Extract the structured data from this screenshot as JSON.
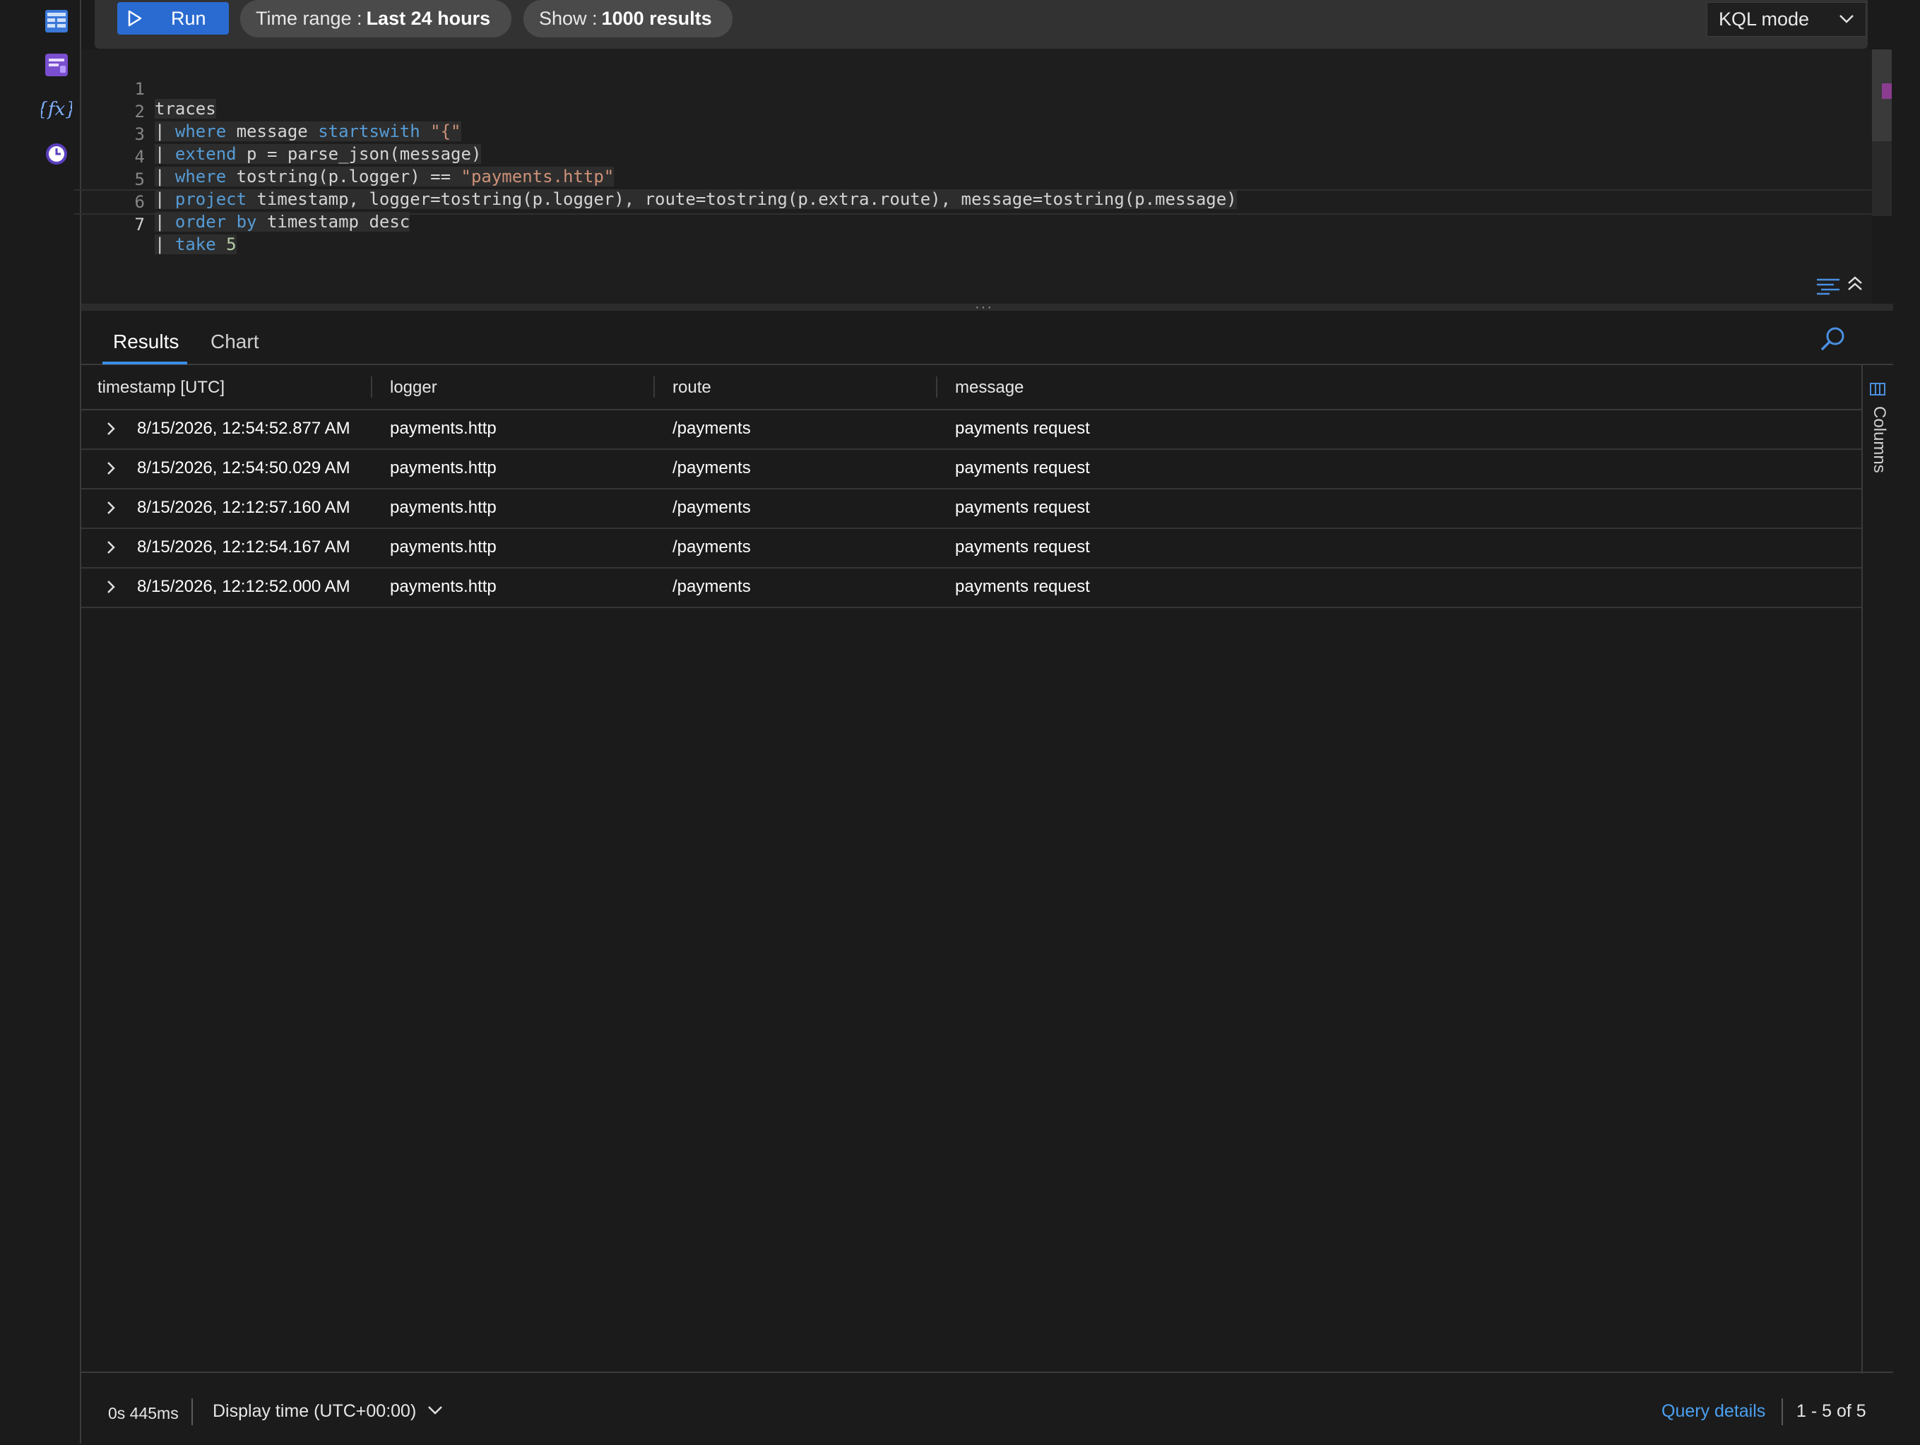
{
  "rail": {
    "icons": [
      "tables-icon",
      "queries-icon",
      "functions-icon",
      "query-history-icon"
    ]
  },
  "toolbar": {
    "run_label": "Run",
    "time_range_label": "Time range :",
    "time_range_value": "Last 24 hours",
    "show_label": "Show :",
    "show_value": "1000 results",
    "mode_value": "KQL mode"
  },
  "editor": {
    "lines": [
      {
        "num": "1",
        "text": "traces"
      },
      {
        "num": "2",
        "text": "| where message startswith \"{\""
      },
      {
        "num": "3",
        "text": "| extend p = parse_json(message)"
      },
      {
        "num": "4",
        "text": "| where tostring(p.logger) == \"payments.http\""
      },
      {
        "num": "5",
        "text": "| project timestamp, logger=tostring(p.logger), route=tostring(p.extra.route), message=tostring(p.message)"
      },
      {
        "num": "6",
        "text": "| order by timestamp desc"
      },
      {
        "num": "7",
        "text": "| take 5"
      }
    ]
  },
  "results": {
    "tabs": [
      "Results",
      "Chart"
    ],
    "active_tab": "Results",
    "columns": [
      "timestamp [UTC]",
      "logger",
      "route",
      "message"
    ],
    "rows": [
      [
        "8/15/2026, 12:54:52.877 AM",
        "payments.http",
        "/payments",
        "payments request"
      ],
      [
        "8/15/2026, 12:54:50.029 AM",
        "payments.http",
        "/payments",
        "payments request"
      ],
      [
        "8/15/2026, 12:12:57.160 AM",
        "payments.http",
        "/payments",
        "payments request"
      ],
      [
        "8/15/2026, 12:12:54.167 AM",
        "payments.http",
        "/payments",
        "payments request"
      ],
      [
        "8/15/2026, 12:12:52.000 AM",
        "payments.http",
        "/payments",
        "payments request"
      ]
    ],
    "columns_panel_label": "Columns"
  },
  "footer": {
    "duration": "0s 445ms",
    "display_time": "Display time (UTC+00:00)",
    "query_details": "Query details",
    "paging": "1 - 5 of 5"
  },
  "colors": {
    "accent": "#2a6bd1",
    "link": "#4aa0f0",
    "keyword": "#569cd6",
    "string": "#ce9178",
    "number": "#b5cea8"
  }
}
